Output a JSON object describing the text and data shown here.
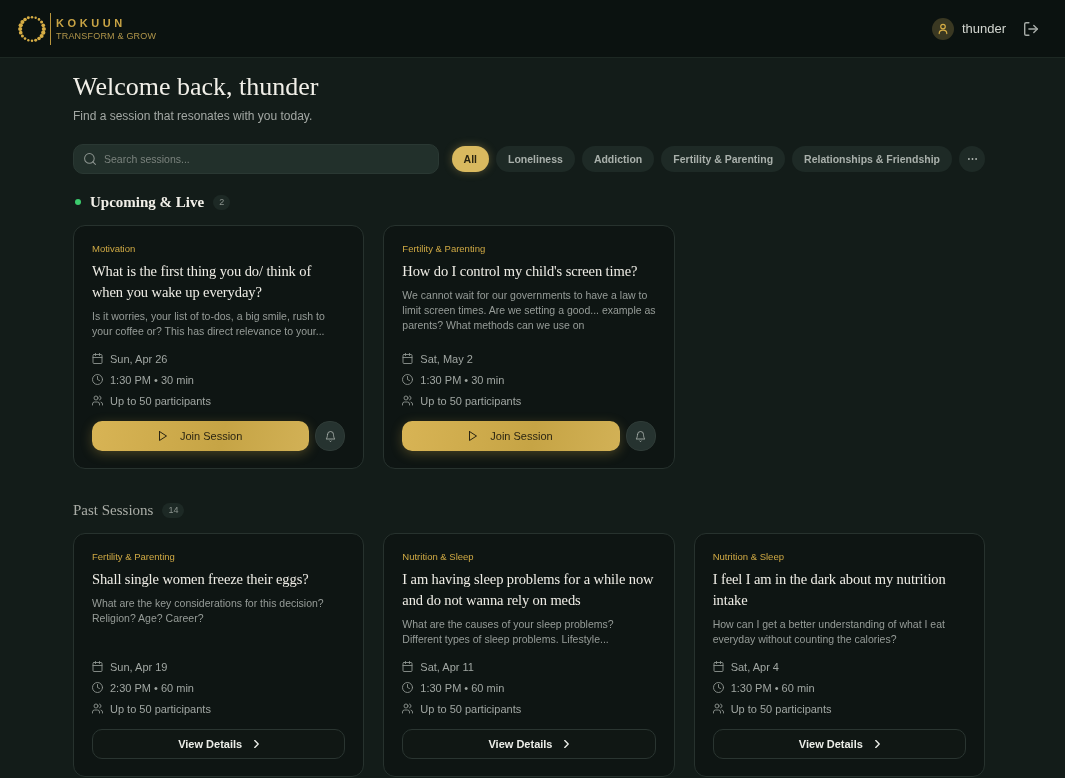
{
  "header": {
    "logo": {
      "name": "KOKUUN",
      "tagline": "TRANSFORM & GROW"
    },
    "user": {
      "name": "thunder"
    }
  },
  "welcome": {
    "title": "Welcome back, thunder",
    "subtitle": "Find a session that resonates with you today."
  },
  "search": {
    "placeholder": "Search sessions..."
  },
  "filters": [
    {
      "label": "All",
      "selected": true
    },
    {
      "label": "Loneliness",
      "selected": false
    },
    {
      "label": "Addiction",
      "selected": false
    },
    {
      "label": "Fertility & Parenting",
      "selected": false
    },
    {
      "label": "Relationships & Friendship",
      "selected": false
    }
  ],
  "sections": [
    {
      "kind": "upcoming",
      "title": "Upcoming & Live",
      "count": "2",
      "cards": [
        {
          "category": "Motivation",
          "title": "What is the first thing you do/ think of when you wake up everyday?",
          "description": "Is it worries, your list of to-dos, a big smile, rush to your coffee or? This has direct relevance to your...",
          "date": "Sun, Apr 26",
          "time": "1:30 PM • 30 min",
          "participants": "Up to 50 participants",
          "button": "Join Session"
        },
        {
          "category": "Fertility & Parenting",
          "title": "How do I control my child's screen time?",
          "description": "We cannot wait for our governments to have a law to limit screen times. Are we setting a good... example as parents? What methods can we use on",
          "date": "Sat, May 2",
          "time": "1:30 PM • 30 min",
          "participants": "Up to 50 participants",
          "button": "Join Session"
        }
      ]
    },
    {
      "kind": "past",
      "title": "Past Sessions",
      "count": "14",
      "cards": [
        {
          "category": "Fertility & Parenting",
          "title": "Shall single women freeze their eggs?",
          "description": "What are the key considerations for this decision? Religion? Age? Career?",
          "date": "Sun, Apr 19",
          "time": "2:30 PM • 60 min",
          "participants": "Up to 50 participants",
          "button": "View Details"
        },
        {
          "category": "Nutrition & Sleep",
          "title": "I am having sleep problems for a while now and do not wanna rely on meds",
          "description": "What are the causes of your sleep problems? Different types of sleep problems. Lifestyle...",
          "date": "Sat, Apr 11",
          "time": "1:30 PM • 60 min",
          "participants": "Up to 50 participants",
          "button": "View Details"
        },
        {
          "category": "Nutrition & Sleep",
          "title": "I feel I am in the dark about my nutrition intake",
          "description": "How can I get a better understanding of what I eat everyday without counting the calories?",
          "date": "Sat, Apr 4",
          "time": "1:30 PM • 60 min",
          "participants": "Up to 50 participants",
          "button": "View Details"
        }
      ]
    }
  ]
}
